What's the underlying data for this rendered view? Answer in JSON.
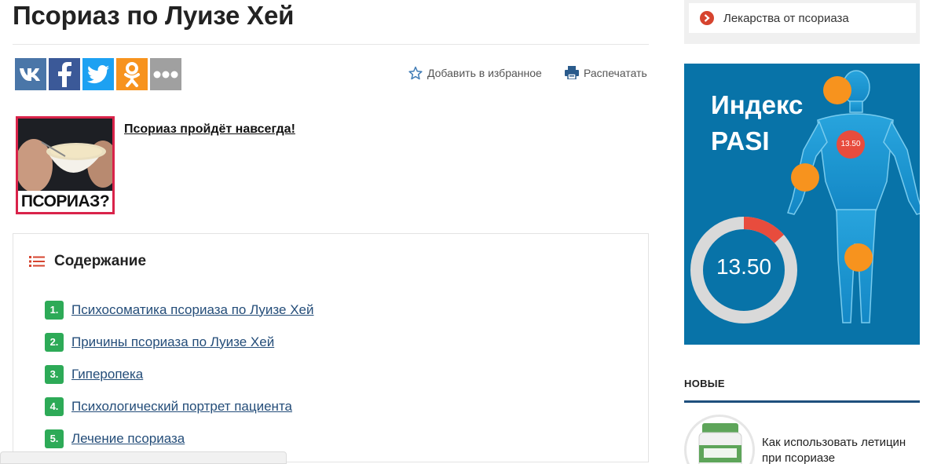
{
  "article": {
    "title": "Псориаз по Луизе Хей",
    "share": {
      "vk": "vk-icon",
      "facebook": "facebook-icon",
      "twitter": "twitter-icon",
      "odnoklassniki": "odnoklassniki-icon",
      "more": "more-icon"
    },
    "actions": {
      "favorite_label": "Добавить в избранное",
      "print_label": "Распечатать"
    },
    "promo": {
      "image_caption": "ПСОРИАЗ?",
      "link_text": "Псориаз пройдёт навсегда!"
    },
    "toc": {
      "title": "Содержание",
      "items": [
        {
          "num": "1.",
          "label": "Психосоматика псориаза по Луизе Хей"
        },
        {
          "num": "2.",
          "label": "Причины псориаза по Луизе Хей"
        },
        {
          "num": "3.",
          "label": "Гиперопека"
        },
        {
          "num": "4.",
          "label": "Психологический портрет пациента"
        },
        {
          "num": "5.",
          "label": "Лечение псориаза"
        }
      ]
    }
  },
  "sidebar": {
    "menu_item": "Лекарства от псориаза",
    "pasi_banner": {
      "title_line1": "Индекс",
      "title_line2": "PASI",
      "value": "13.50",
      "chest_value": "13.50",
      "gauge_fraction": 0.135,
      "colors": {
        "background": "#0873a8",
        "marker": "#f7931e",
        "alert": "#e84c3d",
        "track": "#d9d9d9"
      }
    },
    "news": {
      "heading": "НОВЫЕ",
      "item_title": "Как использовать летицин при псориазе"
    }
  },
  "colors": {
    "toc_number": "#2daa57",
    "link": "#244d79",
    "promo_border": "#d9234a"
  }
}
